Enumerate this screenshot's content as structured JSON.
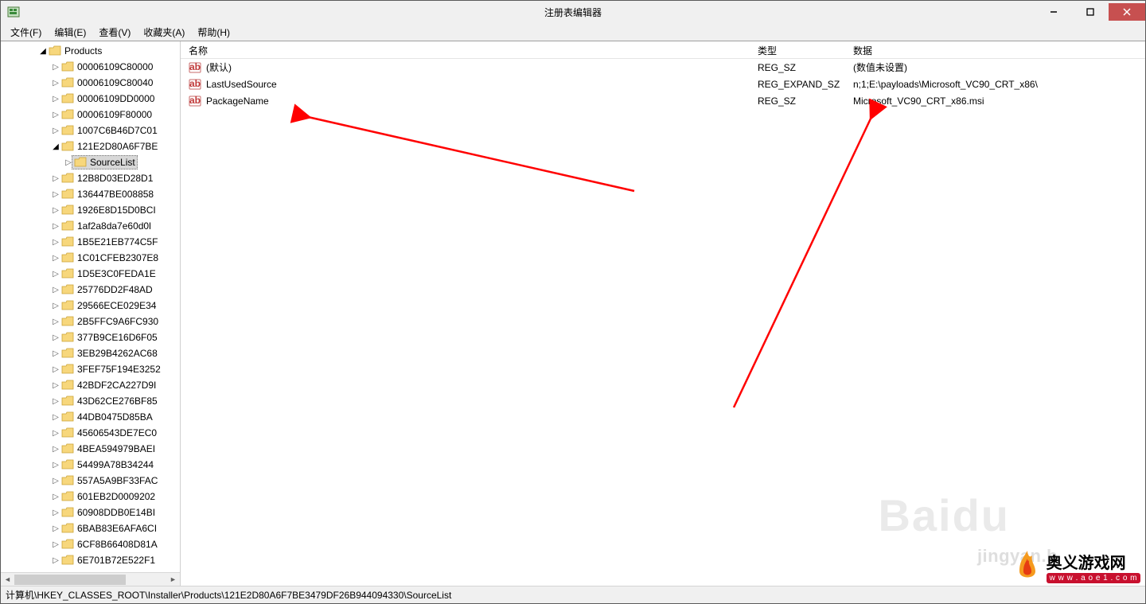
{
  "window": {
    "title": "注册表编辑器"
  },
  "menu": {
    "file": "文件(F)",
    "edit": "编辑(E)",
    "view": "查看(V)",
    "favorites": "收藏夹(A)",
    "help": "帮助(H)"
  },
  "tree": {
    "products_label": "Products",
    "selected_label": "SourceList",
    "items": [
      "00006109C80000",
      "00006109C80040",
      "00006109DD0000",
      "00006109F80000",
      "1007C6B46D7C01",
      "121E2D80A6F7BE",
      "12B8D03ED28D1",
      "136447BE008858",
      "1926E8D15D0BCI",
      "1af2a8da7e60d0l",
      "1B5E21EB774C5F",
      "1C01CFEB2307E8",
      "1D5E3C0FEDA1E",
      "25776DD2F48AD",
      "29566ECE029E34",
      "2B5FFC9A6FC930",
      "377B9CE16D6F05",
      "3EB29B4262AC68",
      "3FEF75F194E3252",
      "42BDF2CA227D9I",
      "43D62CE276BF85",
      "44DB0475D85BA",
      "45606543DE7EC0",
      "4BEA594979BAEI",
      "54499A78B34244",
      "557A5A9BF33FAC",
      "601EB2D0009202",
      "60908DDB0E14BI",
      "6BAB83E6AFA6CI",
      "6CF8B66408D81A",
      "6E701B72E522F1"
    ]
  },
  "list": {
    "headers": {
      "name": "名称",
      "type": "类型",
      "data": "数据"
    },
    "rows": [
      {
        "name": "(默认)",
        "type": "REG_SZ",
        "data": "(数值未设置)"
      },
      {
        "name": "LastUsedSource",
        "type": "REG_EXPAND_SZ",
        "data": "n;1;E:\\payloads\\Microsoft_VC90_CRT_x86\\"
      },
      {
        "name": "PackageName",
        "type": "REG_SZ",
        "data": "Microsoft_VC90_CRT_x86.msi"
      }
    ]
  },
  "statusbar": {
    "path": "计算机\\HKEY_CLASSES_ROOT\\Installer\\Products\\121E2D80A6F7BE3479DF26B944094330\\SourceList"
  },
  "watermark": {
    "baidu": "Baidu",
    "url": "jingyan.b",
    "site_cn": "奥义游戏网",
    "site_url": "w w w . a o e 1 . c o m"
  }
}
